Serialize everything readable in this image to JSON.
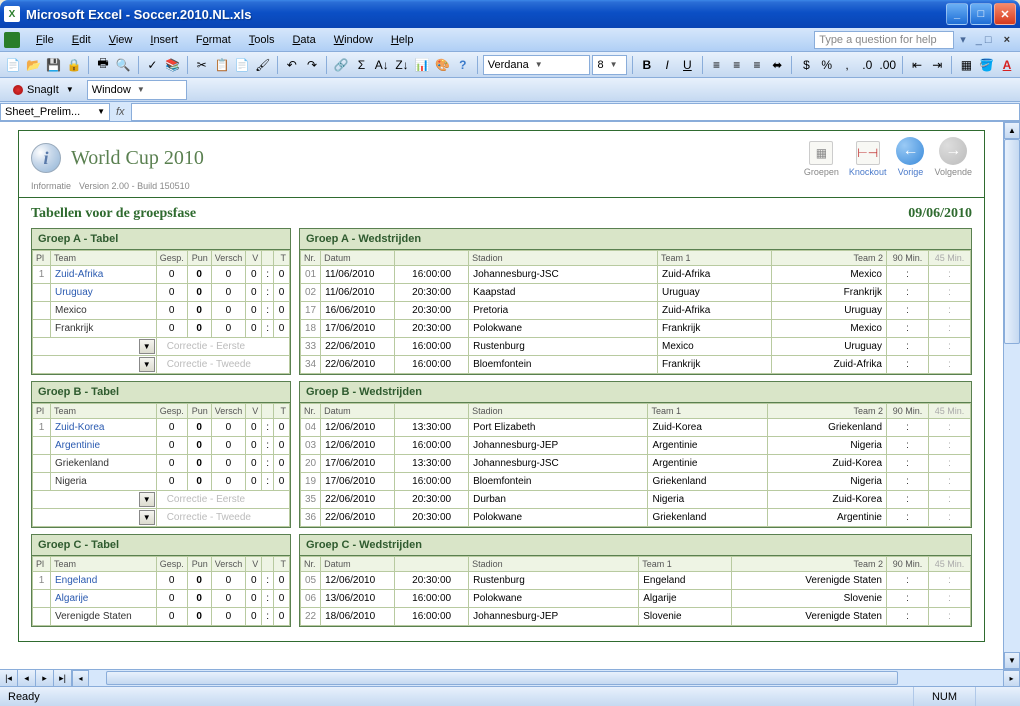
{
  "window": {
    "title": "Microsoft Excel - Soccer.2010.NL.xls"
  },
  "menu": {
    "file": "File",
    "edit": "Edit",
    "view": "View",
    "insert": "Insert",
    "format": "Format",
    "tools": "Tools",
    "data": "Data",
    "window": "Window",
    "help": "Help",
    "question_placeholder": "Type a question for help"
  },
  "fontbox": {
    "font": "Verdana",
    "size": "8"
  },
  "snagit": {
    "label": "SnagIt",
    "window": "Window"
  },
  "namebox": "Sheet_Prelim...",
  "fx": "fx",
  "doc": {
    "title": "World Cup 2010",
    "info": "Informatie",
    "version": "Version 2.00 - Build 150510",
    "subtitle": "Tabellen voor de groepsfase",
    "date": "09/06/2010",
    "toolbar": {
      "groepen": "Groepen",
      "knockout": "Knockout",
      "vorige": "Vorige",
      "volgende": "Volgende"
    }
  },
  "tabel_headers": {
    "pl": "Pl",
    "team": "Team",
    "gesp": "Gesp.",
    "pun": "Pun",
    "versch": "Versch",
    "v": "V",
    "t": "T"
  },
  "wed_headers": {
    "nr": "Nr.",
    "datum": "Datum",
    "stadion": "Stadion",
    "team1": "Team 1",
    "team2": "Team 2",
    "m90": "90 Min.",
    "m45": "45 Min."
  },
  "corr1": "Correctie - Eerste",
  "corr2": "Correctie - Tweede",
  "groups": [
    {
      "id": "A",
      "tabel_title": "Groep A - Tabel",
      "wed_title": "Groep A - Wedstrijden",
      "standings": [
        {
          "pl": "1",
          "team": "Zuid-Afrika",
          "link": true,
          "gesp": "0",
          "pun": "0",
          "versch": "0",
          "v": "0",
          "sep": ":",
          "t": "0"
        },
        {
          "pl": "",
          "team": "Uruguay",
          "link": true,
          "gesp": "0",
          "pun": "0",
          "versch": "0",
          "v": "0",
          "sep": ":",
          "t": "0"
        },
        {
          "pl": "",
          "team": "Mexico",
          "link": false,
          "gesp": "0",
          "pun": "0",
          "versch": "0",
          "v": "0",
          "sep": ":",
          "t": "0"
        },
        {
          "pl": "",
          "team": "Frankrijk",
          "link": false,
          "gesp": "0",
          "pun": "0",
          "versch": "0",
          "v": "0",
          "sep": ":",
          "t": "0"
        }
      ],
      "matches": [
        {
          "nr": "01",
          "datum": "11/06/2010",
          "tijd": "16:00:00",
          "stadion": "Johannesburg-JSC",
          "t1": "Zuid-Afrika",
          "t2": "Mexico"
        },
        {
          "nr": "02",
          "datum": "11/06/2010",
          "tijd": "20:30:00",
          "stadion": "Kaapstad",
          "t1": "Uruguay",
          "t2": "Frankrijk"
        },
        {
          "nr": "17",
          "datum": "16/06/2010",
          "tijd": "20:30:00",
          "stadion": "Pretoria",
          "t1": "Zuid-Afrika",
          "t2": "Uruguay"
        },
        {
          "nr": "18",
          "datum": "17/06/2010",
          "tijd": "20:30:00",
          "stadion": "Polokwane",
          "t1": "Frankrijk",
          "t2": "Mexico"
        },
        {
          "nr": "33",
          "datum": "22/06/2010",
          "tijd": "16:00:00",
          "stadion": "Rustenburg",
          "t1": "Mexico",
          "t2": "Uruguay"
        },
        {
          "nr": "34",
          "datum": "22/06/2010",
          "tijd": "16:00:00",
          "stadion": "Bloemfontein",
          "t1": "Frankrijk",
          "t2": "Zuid-Afrika"
        }
      ]
    },
    {
      "id": "B",
      "tabel_title": "Groep B - Tabel",
      "wed_title": "Groep B - Wedstrijden",
      "standings": [
        {
          "pl": "1",
          "team": "Zuid-Korea",
          "link": true,
          "gesp": "0",
          "pun": "0",
          "versch": "0",
          "v": "0",
          "sep": ":",
          "t": "0"
        },
        {
          "pl": "",
          "team": "Argentinie",
          "link": true,
          "gesp": "0",
          "pun": "0",
          "versch": "0",
          "v": "0",
          "sep": ":",
          "t": "0"
        },
        {
          "pl": "",
          "team": "Griekenland",
          "link": false,
          "gesp": "0",
          "pun": "0",
          "versch": "0",
          "v": "0",
          "sep": ":",
          "t": "0"
        },
        {
          "pl": "",
          "team": "Nigeria",
          "link": false,
          "gesp": "0",
          "pun": "0",
          "versch": "0",
          "v": "0",
          "sep": ":",
          "t": "0"
        }
      ],
      "matches": [
        {
          "nr": "04",
          "datum": "12/06/2010",
          "tijd": "13:30:00",
          "stadion": "Port Elizabeth",
          "t1": "Zuid-Korea",
          "t2": "Griekenland"
        },
        {
          "nr": "03",
          "datum": "12/06/2010",
          "tijd": "16:00:00",
          "stadion": "Johannesburg-JEP",
          "t1": "Argentinie",
          "t2": "Nigeria"
        },
        {
          "nr": "20",
          "datum": "17/06/2010",
          "tijd": "13:30:00",
          "stadion": "Johannesburg-JSC",
          "t1": "Argentinie",
          "t2": "Zuid-Korea"
        },
        {
          "nr": "19",
          "datum": "17/06/2010",
          "tijd": "16:00:00",
          "stadion": "Bloemfontein",
          "t1": "Griekenland",
          "t2": "Nigeria"
        },
        {
          "nr": "35",
          "datum": "22/06/2010",
          "tijd": "20:30:00",
          "stadion": "Durban",
          "t1": "Nigeria",
          "t2": "Zuid-Korea"
        },
        {
          "nr": "36",
          "datum": "22/06/2010",
          "tijd": "20:30:00",
          "stadion": "Polokwane",
          "t1": "Griekenland",
          "t2": "Argentinie"
        }
      ]
    },
    {
      "id": "C",
      "tabel_title": "Groep C - Tabel",
      "wed_title": "Groep C - Wedstrijden",
      "standings": [
        {
          "pl": "1",
          "team": "Engeland",
          "link": true,
          "gesp": "0",
          "pun": "0",
          "versch": "0",
          "v": "0",
          "sep": ":",
          "t": "0"
        },
        {
          "pl": "",
          "team": "Algarije",
          "link": true,
          "gesp": "0",
          "pun": "0",
          "versch": "0",
          "v": "0",
          "sep": ":",
          "t": "0"
        },
        {
          "pl": "",
          "team": "Verenigde Staten",
          "link": false,
          "gesp": "0",
          "pun": "0",
          "versch": "0",
          "v": "0",
          "sep": ":",
          "t": "0"
        }
      ],
      "matches": [
        {
          "nr": "05",
          "datum": "12/06/2010",
          "tijd": "20:30:00",
          "stadion": "Rustenburg",
          "t1": "Engeland",
          "t2": "Verenigde Staten"
        },
        {
          "nr": "06",
          "datum": "13/06/2010",
          "tijd": "16:00:00",
          "stadion": "Polokwane",
          "t1": "Algarije",
          "t2": "Slovenie"
        },
        {
          "nr": "22",
          "datum": "18/06/2010",
          "tijd": "16:00:00",
          "stadion": "Johannesburg-JEP",
          "t1": "Slovenie",
          "t2": "Verenigde Staten"
        }
      ],
      "truncated": true
    }
  ],
  "status": {
    "ready": "Ready",
    "num": "NUM"
  }
}
